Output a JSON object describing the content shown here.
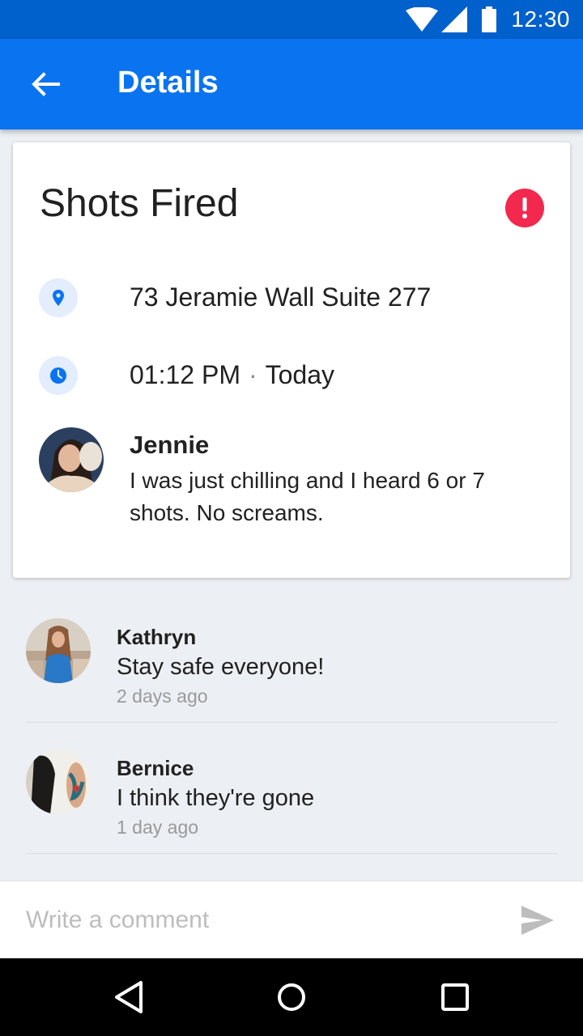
{
  "status_bar": {
    "time": "12:30",
    "icons": [
      "wifi-icon",
      "cell-signal-icon",
      "battery-icon"
    ]
  },
  "app_bar": {
    "title": "Details",
    "back_icon": "arrow-left-icon"
  },
  "incident": {
    "title": "Shots Fired",
    "alert_icon": "exclamation-icon",
    "alert_color": "#f2284e",
    "location": "73 Jeramie Wall Suite 277",
    "time": "01:12 PM",
    "separator": "·",
    "day": "Today",
    "reporter": {
      "name": "Jennie",
      "message": "I was just chilling and I heard 6 or 7 shots. No screams."
    }
  },
  "comments": [
    {
      "author": "Kathryn",
      "text": "Stay safe everyone!",
      "time": "2 days ago"
    },
    {
      "author": "Bernice",
      "text": "I think they're gone",
      "time": "1 day ago"
    }
  ],
  "composer": {
    "placeholder": "Write a comment",
    "value": "",
    "send_icon": "send-icon"
  },
  "nav_bar": {
    "icons": [
      "back-triangle-icon",
      "home-circle-icon",
      "recents-square-icon"
    ]
  },
  "colors": {
    "status_bar": "#0060cc",
    "app_bar": "#0a73f0",
    "accent_blue": "#0a73f0",
    "background": "#eceff3"
  }
}
